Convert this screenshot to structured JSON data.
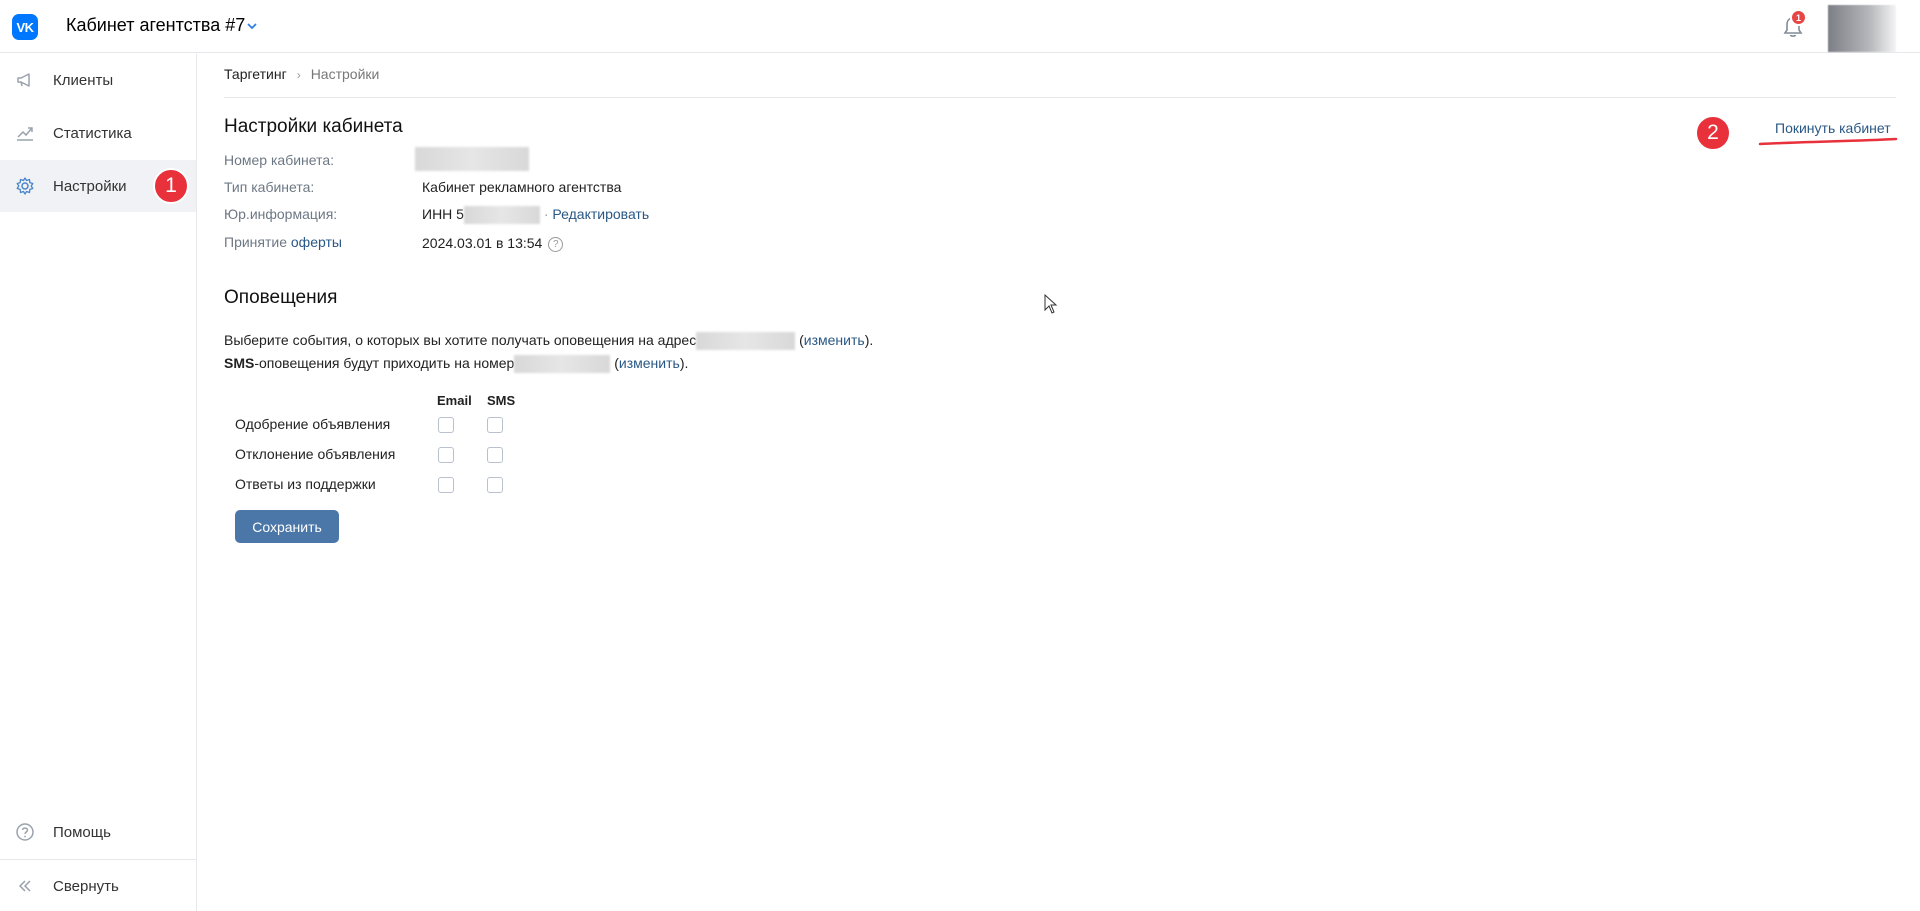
{
  "header": {
    "logo_text": "VK",
    "cabinet_title": "Кабинет агентства #7",
    "notification_count": "1"
  },
  "sidebar": {
    "items": [
      {
        "label": "Клиенты",
        "icon": "megaphone-icon"
      },
      {
        "label": "Статистика",
        "icon": "chart-icon"
      },
      {
        "label": "Настройки",
        "icon": "gear-icon",
        "active": true
      }
    ],
    "bottom_items": [
      {
        "label": "Помощь",
        "icon": "help-icon"
      },
      {
        "label": "Свернуть",
        "icon": "collapse-icon"
      }
    ],
    "step_badge": "1"
  },
  "breadcrumb": {
    "parent": "Таргетинг",
    "current": "Настройки"
  },
  "settings": {
    "title": "Настройки кабинета",
    "leave_label": "Покинуть кабинет",
    "step_badge": "2",
    "fields": {
      "number_label": "Номер кабинета:",
      "type_label": "Тип кабинета:",
      "type_value": "Кабинет рекламного агентства",
      "legal_label": "Юр.информация:",
      "legal_prefix": "ИНН 5",
      "edit_link": "Редактировать",
      "offer_label_prefix": "Принятие ",
      "offer_label_link": "оферты",
      "offer_value": "2024.03.01 в 13:54"
    }
  },
  "notifications": {
    "title": "Оповещения",
    "email_text": "Выберите события, о которых вы хотите получать оповещения на адрес",
    "change_label": "изменить",
    "sms_bold": "SMS",
    "sms_text": "-оповещения будут приходить на номер",
    "columns": [
      "Email",
      "SMS"
    ],
    "rows": [
      {
        "label": "Одобрение объявления",
        "email": false,
        "sms": false
      },
      {
        "label": "Отклонение объявления",
        "email": false,
        "sms": false
      },
      {
        "label": "Ответы из поддержки",
        "email": false,
        "sms": false
      }
    ],
    "save_label": "Сохранить"
  },
  "colors": {
    "accent": "#0077ff",
    "link": "#2a5885",
    "button": "#4a76a8",
    "badge_red": "#e8313b"
  }
}
